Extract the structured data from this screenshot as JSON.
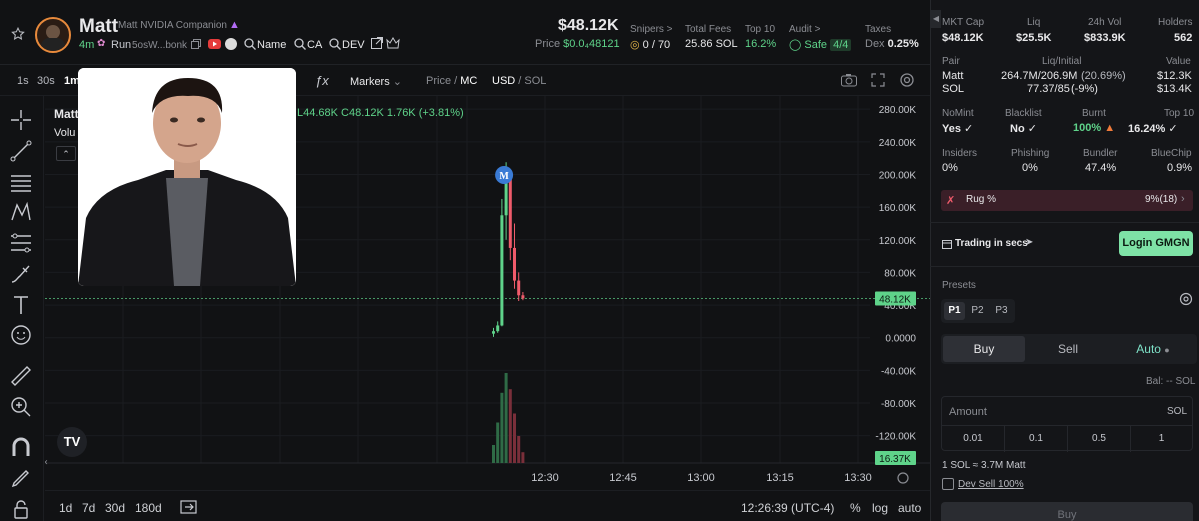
{
  "token": {
    "symbol": "Matt",
    "name": "Matt NVIDIA Companion",
    "age": "4m",
    "launchpad": "Run",
    "address": "5osW...bonk",
    "links": [
      "Name",
      "CA",
      "DEV"
    ]
  },
  "header_stats": {
    "market_cap": "$48.12K",
    "price_label": "Price",
    "price_value": "$0.0₄48121",
    "snipers_label": "Snipers >",
    "snipers_value": "0 / 70",
    "total_fees_label": "Total Fees",
    "total_fees_value": "25.86 SOL",
    "top10_label": "Top 10",
    "top10_value": "16.2%",
    "audit_label": "Audit >",
    "audit_value": "Safe",
    "audit_score": "4/4",
    "taxes_label": "Taxes",
    "taxes_prefix": "Dex",
    "taxes_value": "0.25%"
  },
  "chart_toolbar": {
    "intervals": [
      "1s",
      "30s",
      "1m"
    ],
    "markers": "Markers",
    "price_toggle_a": "Price",
    "price_toggle_sep": " / ",
    "price_toggle_b": "MC",
    "currency_a": "USD",
    "currency_sep": " / ",
    "currency_b": "SOL"
  },
  "chart_legend": {
    "symbol": "Matt",
    "volume_label": "Volu",
    "ohlc": "L44.68K  C48.12K  1.76K (+3.81%)"
  },
  "chart_data": {
    "type": "candlestick",
    "y_ticks": [
      "280.00K",
      "240.00K",
      "200.00K",
      "160.00K",
      "120.00K",
      "80.00K",
      "40.00K",
      "0.0000",
      "-40.00K",
      "-80.00K",
      "-120.00K"
    ],
    "x_ticks": [
      "12:30",
      "12:45",
      "13:00",
      "13:15",
      "13:30"
    ],
    "ylim": [
      -140000,
      290000
    ],
    "current_price_label": "48.12K",
    "current_price": 48120,
    "volume_label": "16.37K",
    "marker_label": "M",
    "candles": [
      {
        "o": 5000,
        "h": 12000,
        "l": 1000,
        "c": 8000
      },
      {
        "o": 8000,
        "h": 20000,
        "l": 6000,
        "c": 15000
      },
      {
        "o": 15000,
        "h": 170000,
        "l": 14000,
        "c": 150000
      },
      {
        "o": 150000,
        "h": 215000,
        "l": 120000,
        "c": 200000
      },
      {
        "o": 200000,
        "h": 205000,
        "l": 95000,
        "c": 110000
      },
      {
        "o": 110000,
        "h": 140000,
        "l": 60000,
        "c": 70000
      },
      {
        "o": 70000,
        "h": 80000,
        "l": 45000,
        "c": 52000
      },
      {
        "o": 52000,
        "h": 56000,
        "l": 46000,
        "c": 48120
      }
    ],
    "volumes": [
      0.2,
      0.45,
      0.78,
      1.0,
      0.82,
      0.55,
      0.3,
      0.12
    ]
  },
  "bottom_bar": {
    "ranges": [
      "1d",
      "7d",
      "30d",
      "180d"
    ],
    "time": "12:26:39 (UTC-4)",
    "percent": "%",
    "log": "log",
    "auto": "auto"
  },
  "right_panel": {
    "row1": [
      {
        "label": "MKT Cap",
        "value": "$48.12K"
      },
      {
        "label": "Liq",
        "value": "$25.5K"
      },
      {
        "label": "24h Vol",
        "value": "$833.9K"
      },
      {
        "label": "Holders",
        "value": "562"
      }
    ],
    "pair_label": "Pair",
    "liq_initial_label": "Liq/Initial",
    "value_label": "Value",
    "pair_rows": [
      {
        "pair": "Matt",
        "liq": "264.7M/206.9M",
        "change": "(20.69%)",
        "value": "$12.3K"
      },
      {
        "pair": "SOL",
        "liq": "77.37/85",
        "change": "(-9%)",
        "value": "$13.4K"
      }
    ],
    "row3": [
      {
        "label": "NoMint",
        "value": "Yes"
      },
      {
        "label": "Blacklist",
        "value": "No"
      },
      {
        "label": "Burnt",
        "value": "100%"
      },
      {
        "label": "Top 10",
        "value": "16.24%"
      }
    ],
    "row4": [
      {
        "label": "Insiders",
        "value": "0%"
      },
      {
        "label": "Phishing",
        "value": "0%"
      },
      {
        "label": "Bundler",
        "value": "47.4%"
      },
      {
        "label": "BlueChip",
        "value": "0.9%"
      }
    ],
    "rug_label": "Rug %",
    "rug_value": "9%(18)",
    "trading_label": "Trading in secs",
    "login_label": "Login GMGN",
    "presets_label": "Presets",
    "preset_tabs": [
      "P1",
      "P2",
      "P3"
    ],
    "buy_tab": "Buy",
    "sell_tab": "Sell",
    "auto_tab": "Auto",
    "balance": "Bal: -- SOL",
    "amount_label": "Amount",
    "amount_unit": "SOL",
    "amounts": [
      "0.01",
      "0.1",
      "0.5",
      "1"
    ],
    "conversion": "1 SOL ≈ 3.7M Matt",
    "dev_sell": "Dev Sell 100%",
    "buy_button": "Buy"
  },
  "colors": {
    "accent_green": "#5fd38a",
    "accent_red": "#ef5b6b",
    "login_green": "#7ee2a6",
    "background": "#111214"
  }
}
